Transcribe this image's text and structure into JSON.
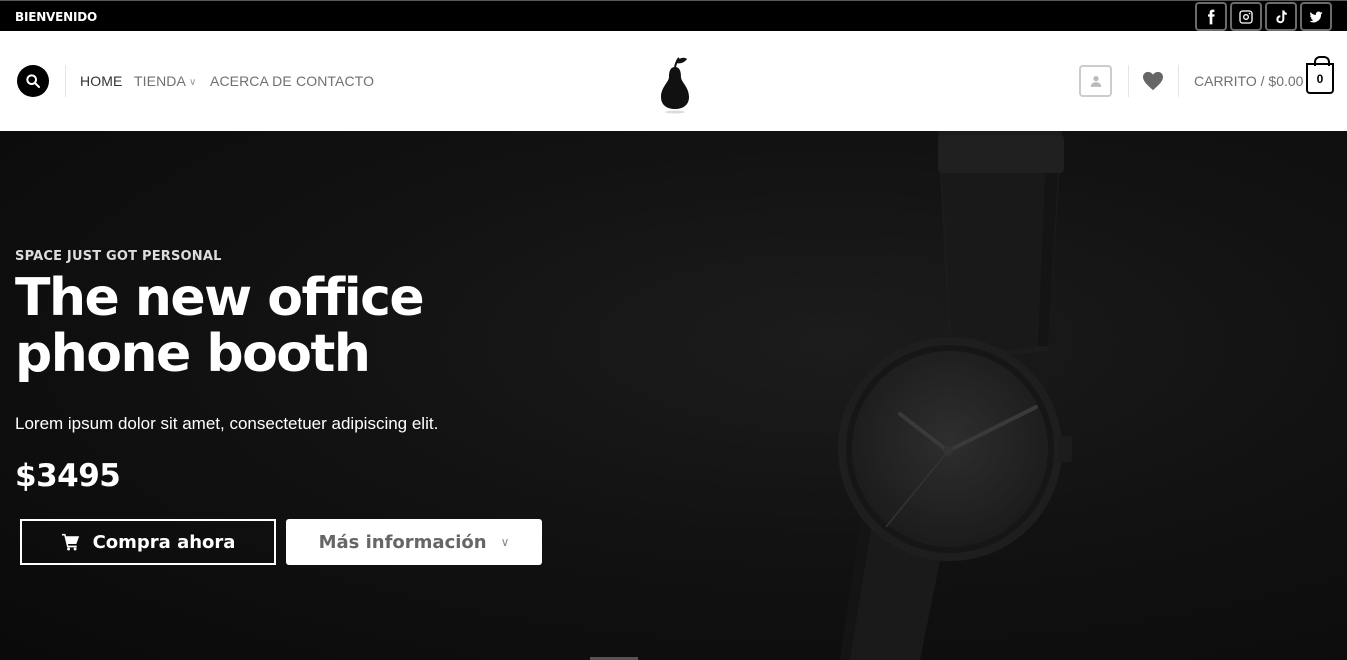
{
  "topbar": {
    "welcome": "BIENVENIDO",
    "social": [
      "facebook-icon",
      "instagram-icon",
      "tiktok-icon",
      "twitter-icon"
    ]
  },
  "nav": {
    "items": [
      {
        "label": "HOME",
        "active": true
      },
      {
        "label": "TIENDA",
        "dropdown": true
      },
      {
        "label": "ACERCA DE"
      },
      {
        "label": "CONTACTO"
      }
    ]
  },
  "header": {
    "logo": "pear-logo",
    "cart_label": "CARRITO / $0.00",
    "cart_count": "0"
  },
  "hero": {
    "eyebrow": "SPACE JUST GOT PERSONAL",
    "headline_line1": "The new office",
    "headline_line2": "phone booth",
    "description": "Lorem ipsum dolor sit amet, consectetuer adipiscing elit.",
    "price": "$3495",
    "buy_label": "Compra ahora",
    "more_label": "Más información"
  },
  "colors": {
    "topbar_bg": "#000000",
    "header_bg": "#ffffff",
    "hero_bg": "#0f0f0f",
    "accent": "#000000"
  }
}
